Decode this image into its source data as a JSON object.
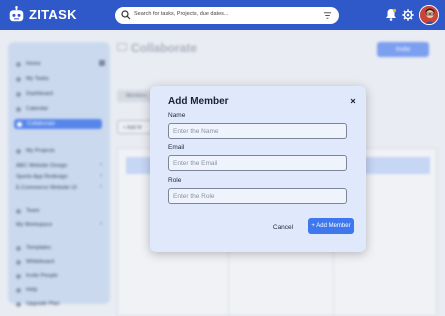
{
  "app": {
    "name": "ZITASK",
    "brand_color": "#2f58c9",
    "accent_color": "#3f78ee"
  },
  "search": {
    "placeholder": "Search for tasks, Projects, due dates..."
  },
  "header": {
    "icons": [
      "bell-icon",
      "gear-icon",
      "avatar"
    ]
  },
  "page": {
    "title": "Collaborate",
    "invite_label": "Invite",
    "tab_label": "Members",
    "add_label": "+ Add M"
  },
  "sidebar": {
    "items": [
      {
        "label": "Home"
      },
      {
        "label": "My Tasks"
      },
      {
        "label": "Dashboard"
      },
      {
        "label": "Calendar"
      },
      {
        "label": "Collaborate",
        "active": true
      }
    ],
    "projects_header": "My Projects",
    "projects": [
      {
        "label": "ABC Website Design"
      },
      {
        "label": "Sports App Redesign"
      },
      {
        "label": "E-Commerce Website UI"
      }
    ],
    "team_label": "Team",
    "workspace_label": "My Workspace",
    "bottom_items": [
      {
        "label": "Templates"
      },
      {
        "label": "Whiteboard"
      },
      {
        "label": "Invite People"
      },
      {
        "label": "Help"
      },
      {
        "label": "Upgrade Plan"
      }
    ]
  },
  "modal": {
    "title": "Add Member",
    "fields": [
      {
        "label": "Name",
        "placeholder": "Enter the Name",
        "value": ""
      },
      {
        "label": "Email",
        "placeholder": "Enter the Email",
        "value": ""
      },
      {
        "label": "Role",
        "placeholder": "Enter the Role",
        "value": ""
      }
    ],
    "cancel_label": "Cancel",
    "submit_label": "+ Add Member"
  }
}
